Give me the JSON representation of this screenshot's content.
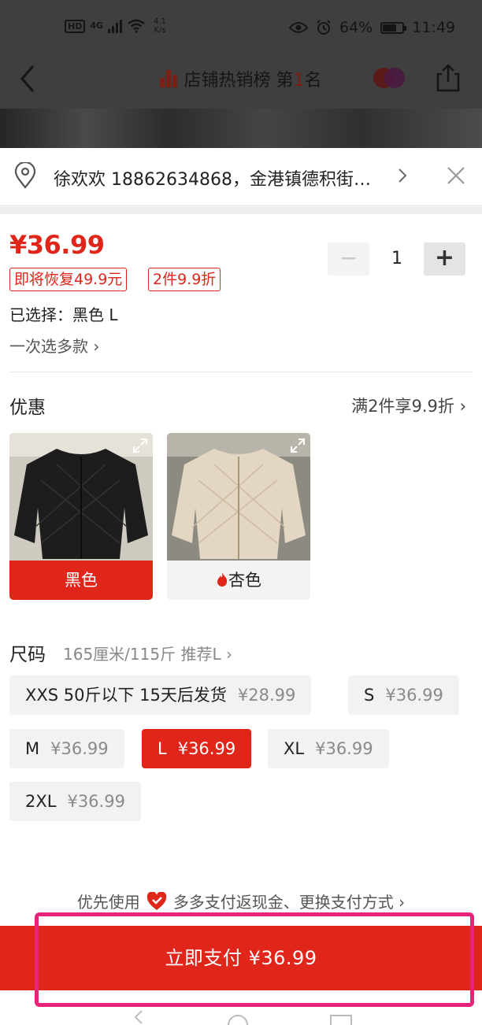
{
  "status_bar": {
    "hd": "HD",
    "network": "4G",
    "speed_value": "4.1",
    "speed_unit": "K/s",
    "battery": "64%",
    "time": "11:49"
  },
  "nav": {
    "title_prefix": "店铺热销榜 第",
    "rank": "1",
    "title_suffix": "名"
  },
  "address": {
    "text": "徐欢欢 18862634868，金港镇德积街…"
  },
  "product": {
    "price": "¥36.99",
    "tags": [
      "即将恢复49.9元",
      "2件9.9折"
    ],
    "quantity": "1",
    "minus": "−",
    "plus": "+",
    "selected_label": "已选择：",
    "selected_value": "黑色 L",
    "multi_select": "一次选多款 ›"
  },
  "promo": {
    "title": "优惠",
    "right": "满2件享9.9折 ›"
  },
  "colors": [
    {
      "label": "黑色",
      "selected": true
    },
    {
      "label": "杏色",
      "selected": false,
      "hot": true
    }
  ],
  "size": {
    "title": "尺码",
    "hint": "165厘米/115斤 推荐L ›",
    "options": [
      {
        "label": "XXS 50斤以下 15天后发货",
        "price": "¥28.99"
      },
      {
        "label": "S",
        "price": "¥36.99"
      },
      {
        "label": "M",
        "price": "¥36.99"
      },
      {
        "label": "L",
        "price": "¥36.99",
        "selected": true
      },
      {
        "label": "XL",
        "price": "¥36.99"
      },
      {
        "label": "2XL",
        "price": "¥36.99"
      }
    ]
  },
  "payment": {
    "hint_prefix": "优先使用",
    "hint_text": "多多支付返现金、更换支付方式 ›",
    "button": "立即支付 ¥36.99"
  },
  "colors_theme": {
    "accent": "#e0251b",
    "highlight": "#e8247a"
  }
}
